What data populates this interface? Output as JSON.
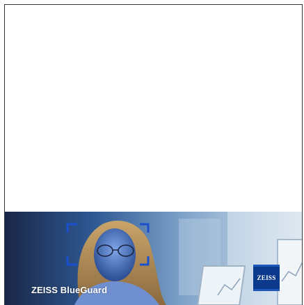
{
  "banner": {
    "product_name": "ZEISS BlueGuard",
    "logo_text": "ZEISS"
  },
  "colors": {
    "logo_blue": "#0b3a8c",
    "frame_border": "#333333",
    "focus_bracket": "#1a4fcf"
  },
  "icons": {
    "logo": "zeiss-logo-icon",
    "focus": "focus-bracket-icon"
  }
}
